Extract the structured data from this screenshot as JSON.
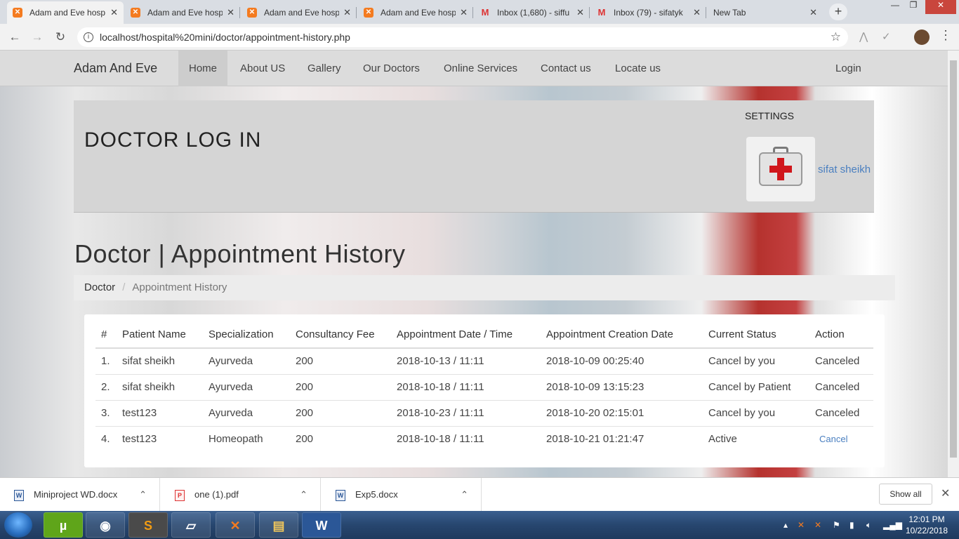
{
  "browser": {
    "tabs": [
      {
        "title": "Adam and Eve hosp",
        "icon": "xampp-icon",
        "active": true
      },
      {
        "title": "Adam and Eve hosp",
        "icon": "xampp-icon",
        "active": false
      },
      {
        "title": "Adam and Eve hosp",
        "icon": "xampp-icon",
        "active": false
      },
      {
        "title": "Adam and Eve hosp",
        "icon": "xampp-icon",
        "active": false
      },
      {
        "title": "Inbox (1,680) - siffu",
        "icon": "gmail-icon",
        "active": false
      },
      {
        "title": "Inbox (79) - sifatyk",
        "icon": "gmail-icon",
        "active": false
      },
      {
        "title": "New Tab",
        "icon": "",
        "active": false
      }
    ],
    "url": "localhost/hospital%20mini/doctor/appointment-history.php"
  },
  "navbar": {
    "brand": "Adam And Eve",
    "items": [
      "Home",
      "About US",
      "Gallery",
      "Our Doctors",
      "Online Services",
      "Contact us",
      "Locate us"
    ],
    "login": "Login"
  },
  "header": {
    "title": "DOCTOR LOG IN",
    "settings": "SETTINGS",
    "username": "sifat sheikh"
  },
  "main": {
    "page_title": "Doctor | Appointment History",
    "breadcrumb": [
      "Doctor",
      "Appointment History"
    ]
  },
  "table": {
    "columns": [
      "#",
      "Patient Name",
      "Specialization",
      "Consultancy Fee",
      "Appointment Date / Time",
      "Appointment Creation Date",
      "Current Status",
      "Action"
    ],
    "rows": [
      [
        "1.",
        "sifat sheikh",
        "Ayurveda",
        "200",
        "2018-10-13 / 11:11",
        "2018-10-09 00:25:40",
        "Cancel by you",
        "Canceled"
      ],
      [
        "2.",
        "sifat sheikh",
        "Ayurveda",
        "200",
        "2018-10-18 / 11:11",
        "2018-10-09 13:15:23",
        "Cancel by Patient",
        "Canceled"
      ],
      [
        "3.",
        "test123",
        "Ayurveda",
        "200",
        "2018-10-23 / 11:11",
        "2018-10-20 02:15:01",
        "Cancel by you",
        "Canceled"
      ],
      [
        "4.",
        "test123",
        "Homeopath",
        "200",
        "2018-10-18 / 11:11",
        "2018-10-21 01:21:47",
        "Active",
        "Cancel"
      ]
    ]
  },
  "downloads": {
    "items": [
      "Miniproject WD.docx",
      "one (1).pdf",
      "Exp5.docx"
    ],
    "show_all": "Show all"
  },
  "taskbar": {
    "time": "12:01 PM",
    "date": "10/22/2018"
  }
}
